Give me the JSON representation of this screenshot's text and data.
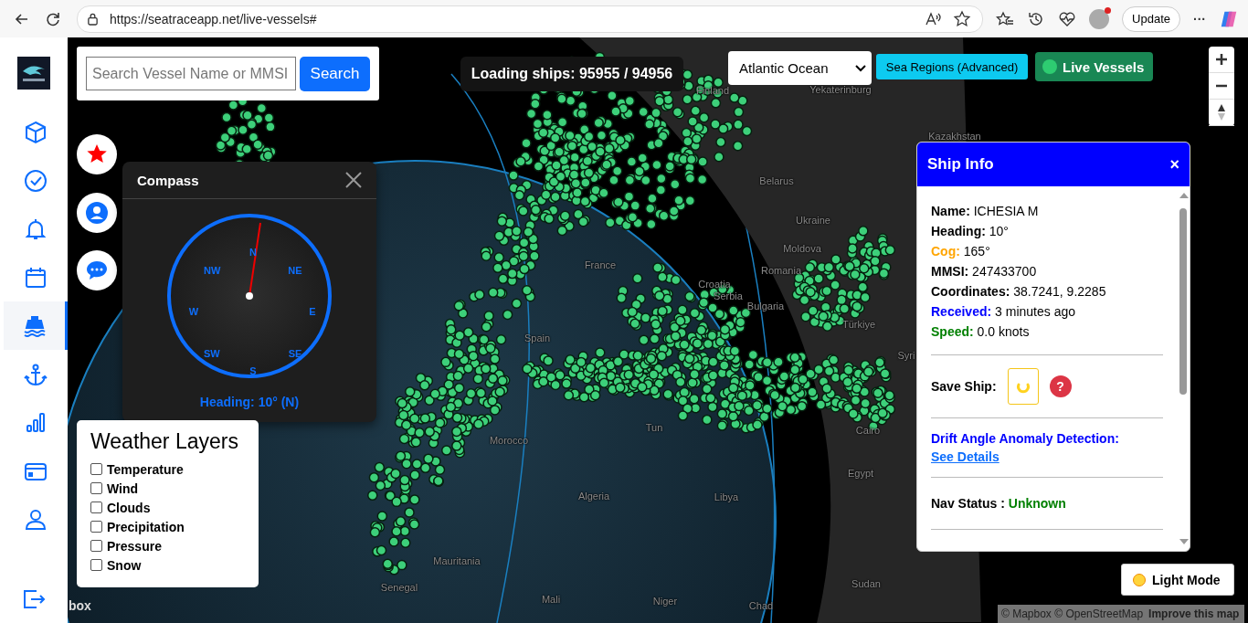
{
  "browser": {
    "url": "https://seatraceapp.net/live-vessels#",
    "update_button": "Update",
    "more_button": "···"
  },
  "sidebar": {
    "items": [
      {
        "selected": false
      },
      {
        "selected": false
      },
      {
        "selected": false
      },
      {
        "selected": false
      },
      {
        "selected": true
      },
      {
        "selected": false
      },
      {
        "selected": false
      },
      {
        "selected": false
      },
      {
        "selected": false
      }
    ]
  },
  "search": {
    "placeholder": "Search Vessel Name or MMSI",
    "button": "Search"
  },
  "loading": "Loading ships: 95955 / 94956",
  "region_select": {
    "value": "Atlantic Ocean"
  },
  "sea_regions_button": "Sea Regions (Advanced)",
  "live_vessels_button": "Live Vessels",
  "map_labels": [
    "Finland",
    "Yekaterinburg",
    "Kazakhstan",
    "Belarus",
    "Ukraine",
    "Moldova",
    "Romania",
    "Croatia",
    "Serbia",
    "Bulgaria",
    "Türkiye",
    "Spain",
    "France",
    "Morocco",
    "Algeria",
    "Libya",
    "Egypt",
    "Mauritania",
    "Mali",
    "Niger",
    "Chad",
    "Sudan",
    "Senegal",
    "Tun",
    "Cairo",
    "Syri"
  ],
  "compass": {
    "title": "Compass",
    "points": [
      "N",
      "NE",
      "E",
      "SE",
      "S",
      "SW",
      "W",
      "NW"
    ],
    "heading": "Heading: 10° (N)"
  },
  "weather_layers": {
    "title": "Weather Layers",
    "items": [
      {
        "label": "Temperature",
        "checked": false
      },
      {
        "label": "Wind",
        "checked": false
      },
      {
        "label": "Clouds",
        "checked": false
      },
      {
        "label": "Precipitation",
        "checked": false
      },
      {
        "label": "Pressure",
        "checked": false
      },
      {
        "label": "Snow",
        "checked": false
      }
    ]
  },
  "ship_info": {
    "title": "Ship Info",
    "close": "×",
    "fields": [
      {
        "label": "Name:",
        "value": "ICHESIA M",
        "color": "#000000"
      },
      {
        "label": "Heading:",
        "value": "10°",
        "color": "#000000"
      },
      {
        "label": "Cog:",
        "value": "165°",
        "color": "#ffa500"
      },
      {
        "label": "MMSI:",
        "value": "247433700",
        "color": "#000000"
      },
      {
        "label": "Coordinates:",
        "value": "38.7241, 9.2285",
        "color": "#000000"
      },
      {
        "label": "Received:",
        "value": "3 minutes ago",
        "color": "#0000ff"
      },
      {
        "label": "Speed:",
        "value": "0.0 knots",
        "color": "#008000"
      }
    ],
    "save_label": "Save Ship:",
    "help": "?",
    "drift_title": "Drift Angle Anomaly Detection:",
    "drift_link": "See Details",
    "nav_status_label": "Nav Status :",
    "nav_status_value": "Unknown"
  },
  "light_mode_button": "Light Mode",
  "mapbox_logo": "box",
  "attribution": {
    "text": "© Mapbox © OpenStreetMap",
    "link": "Improve this map"
  }
}
